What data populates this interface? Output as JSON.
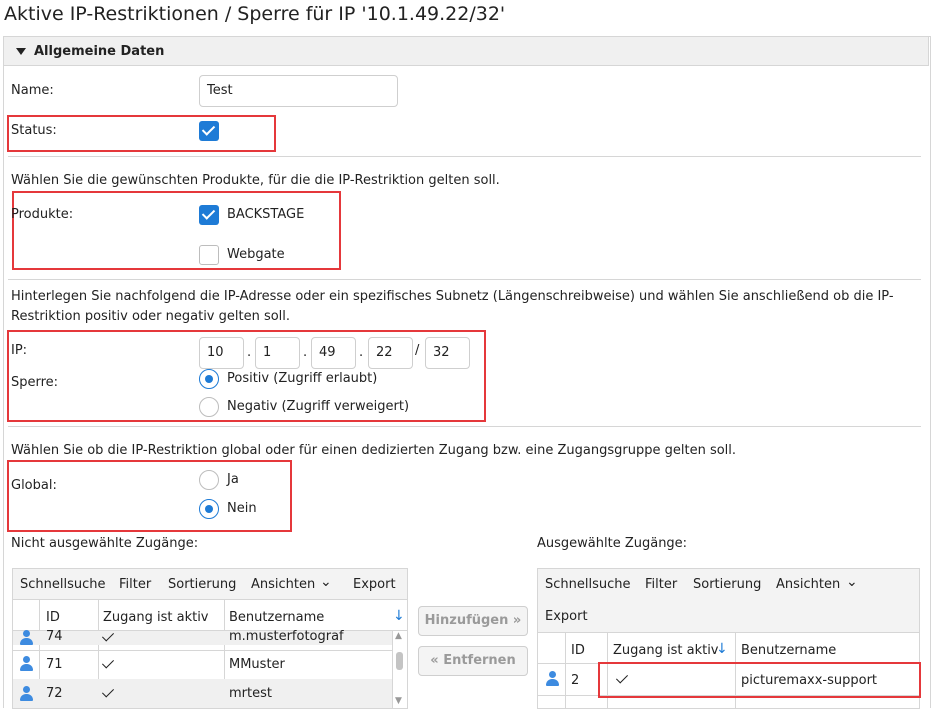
{
  "page": {
    "title": "Aktive IP-Restriktionen / Sperre für IP '10.1.49.22/32'"
  },
  "section": {
    "label": "Allgemeine Daten"
  },
  "form": {
    "name_label": "Name:",
    "name_value": "Test",
    "status_label": "Status:",
    "status_checked": true,
    "products_hint": "Wählen Sie die gewünschten Produkte, für die die IP-Restriktion gelten soll.",
    "products_label": "Produkte:",
    "products": [
      {
        "label": "BACKSTAGE",
        "checked": true
      },
      {
        "label": "Webgate",
        "checked": false
      }
    ],
    "ip_hint_line1": "Hinterlegen Sie nachfolgend die IP-Adresse oder ein spezifisches Subnetz (Längenschreibweise) und wählen Sie anschließend ob die IP-",
    "ip_hint_line2": "Restriktion positiv oder negativ gelten soll.",
    "ip_label": "IP:",
    "ip_octets": [
      "10",
      "1",
      "49",
      "22"
    ],
    "ip_dot": ".",
    "ip_slash": "/",
    "ip_prefix": "32",
    "sperre_label": "Sperre:",
    "sperre_options": [
      {
        "label": "Positiv (Zugriff erlaubt)",
        "selected": true
      },
      {
        "label": "Negativ (Zugriff verweigert)",
        "selected": false
      }
    ],
    "global_hint": "Wählen Sie ob die IP-Restriktion global oder für einen dedizierten Zugang bzw. eine Zugangsgruppe gelten soll.",
    "global_label": "Global:",
    "global_options": [
      {
        "label": "Ja",
        "selected": false
      },
      {
        "label": "Nein",
        "selected": true
      }
    ]
  },
  "left_list": {
    "label": "Nicht ausgewählte Zugänge:",
    "toolbar": [
      "Schnellsuche",
      "Filter",
      "Sortierung",
      "Ansichten",
      "Export"
    ],
    "columns": [
      "ID",
      "Zugang ist aktiv",
      "Benutzername"
    ],
    "sort_icon": "arrow-down-icon",
    "rows": [
      {
        "id": "74",
        "active": true,
        "username": "m.musterfotograf"
      },
      {
        "id": "71",
        "active": true,
        "username": "MMuster"
      },
      {
        "id": "72",
        "active": true,
        "username": "mrtest"
      }
    ]
  },
  "actions": {
    "add": "Hinzufügen",
    "remove": "Entfernen"
  },
  "right_list": {
    "label": "Ausgewählte Zugänge:",
    "toolbar": [
      "Schnellsuche",
      "Filter",
      "Sortierung",
      "Ansichten",
      "Export"
    ],
    "columns": [
      "ID",
      "Zugang ist aktiv",
      "Benutzername"
    ],
    "sort_icon": "arrow-down-icon",
    "rows": [
      {
        "id": "2",
        "active": true,
        "username": "picturemaxx-support"
      }
    ]
  },
  "colors": {
    "accent": "#1e7bd6",
    "highlight": "#e5383b",
    "border": "#d6d6d6"
  }
}
